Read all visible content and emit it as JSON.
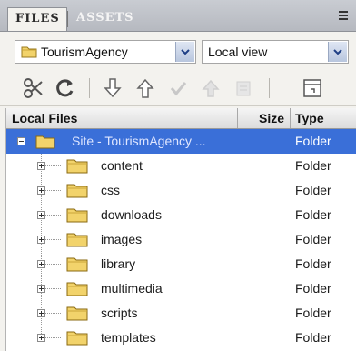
{
  "tabs": [
    {
      "label": "FILES",
      "active": true
    },
    {
      "label": "ASSETS",
      "active": false
    }
  ],
  "site_select": {
    "value": "TourismAgency",
    "icon": "folder-icon"
  },
  "view_select": {
    "value": "Local view"
  },
  "toolbar": {
    "buttons": [
      {
        "name": "connect-icon",
        "enabled": true
      },
      {
        "name": "refresh-icon",
        "enabled": true
      },
      {
        "name": "get-files-icon",
        "enabled": true
      },
      {
        "name": "put-files-icon",
        "enabled": true
      },
      {
        "name": "check-out-icon",
        "enabled": false
      },
      {
        "name": "check-in-icon",
        "enabled": false
      },
      {
        "name": "sync-icon",
        "enabled": false
      },
      {
        "name": "expand-panel-icon",
        "enabled": true
      }
    ]
  },
  "table": {
    "columns": [
      "Local Files",
      "Size",
      "Type"
    ],
    "root": {
      "name": "Site - TourismAgency ...",
      "type": "Folder"
    },
    "rows": [
      {
        "name": "content",
        "type": "Folder"
      },
      {
        "name": "css",
        "type": "Folder"
      },
      {
        "name": "downloads",
        "type": "Folder"
      },
      {
        "name": "images",
        "type": "Folder"
      },
      {
        "name": "library",
        "type": "Folder"
      },
      {
        "name": "multimedia",
        "type": "Folder"
      },
      {
        "name": "scripts",
        "type": "Folder"
      },
      {
        "name": "templates",
        "type": "Folder"
      }
    ]
  },
  "colors": {
    "selection": "#3a6fd8",
    "folder": "#f2d36b"
  }
}
